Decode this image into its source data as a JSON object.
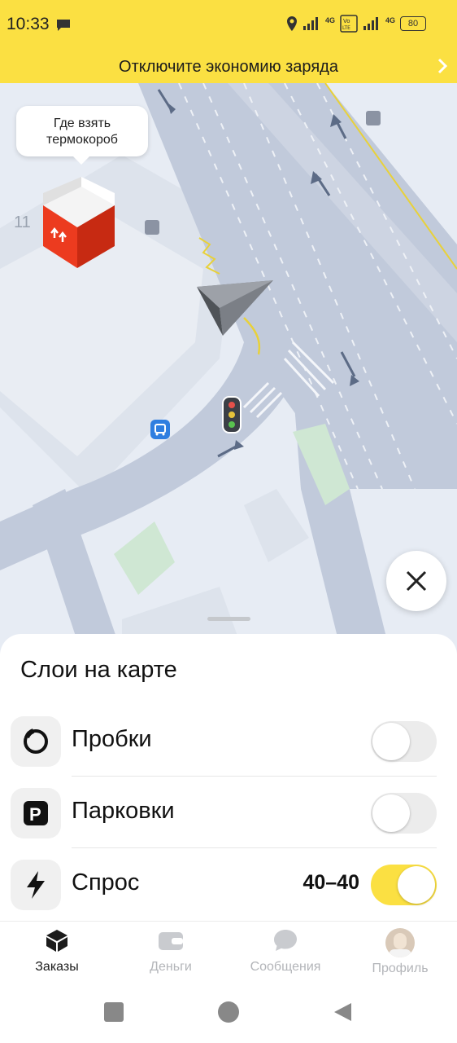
{
  "status_bar": {
    "time": "10:33",
    "battery": "80",
    "net1": "4G",
    "net2": "4G"
  },
  "banner": {
    "text": "Отключите экономию заряда"
  },
  "map": {
    "tooltip_line1": "Где взять",
    "tooltip_line2": "термокороб",
    "building_number": "11"
  },
  "sheet": {
    "title": "Слои на карте",
    "layers": [
      {
        "label": "Пробки",
        "icon": "traffic-icon",
        "enabled": false
      },
      {
        "label": "Парковки",
        "icon": "parking-icon",
        "enabled": false
      },
      {
        "label": "Спрос",
        "icon": "lightning-icon",
        "value": "40–40",
        "enabled": true
      }
    ]
  },
  "nav": {
    "tabs": [
      {
        "label": "Заказы",
        "icon": "orders-cube-icon",
        "active": true
      },
      {
        "label": "Деньги",
        "icon": "wallet-icon",
        "active": false
      },
      {
        "label": "Сообщения",
        "icon": "chat-icon",
        "active": false
      },
      {
        "label": "Профиль",
        "icon": "avatar",
        "active": false
      }
    ]
  },
  "colors": {
    "accent": "#fbe042",
    "map_road": "#c1cadb",
    "map_bg": "#e7ecf4"
  }
}
